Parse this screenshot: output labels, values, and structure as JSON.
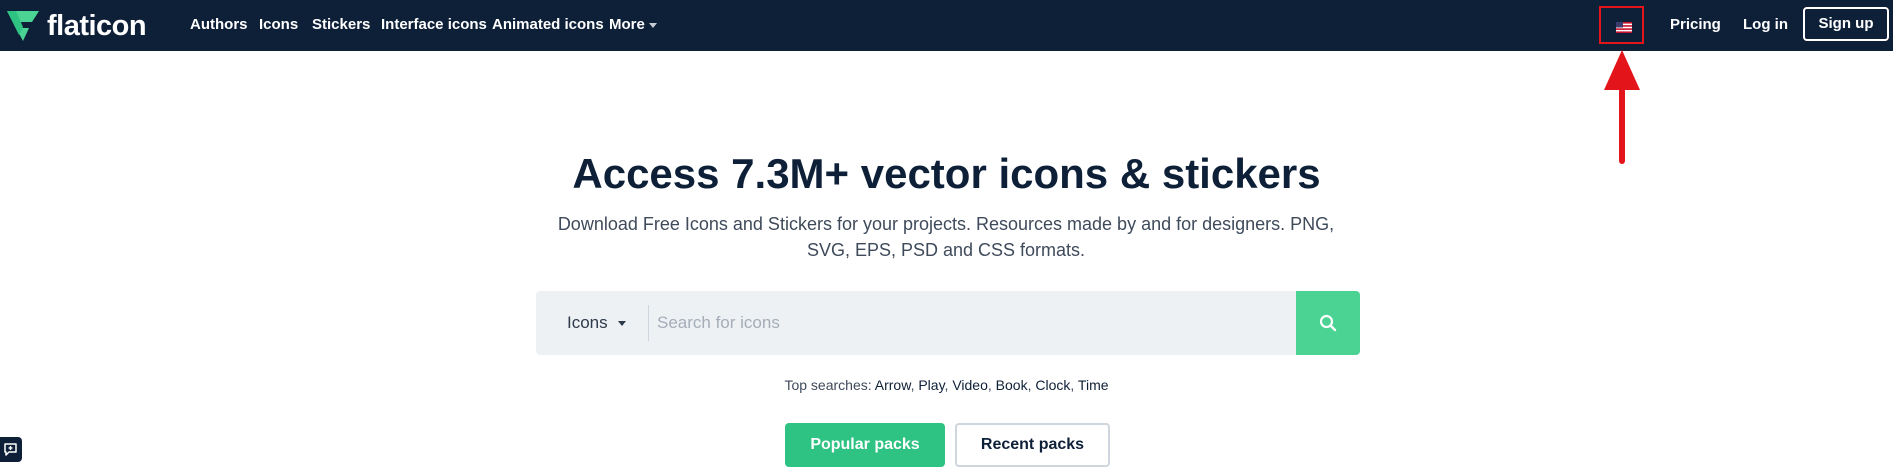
{
  "header": {
    "brand": "flaticon",
    "nav": [
      "Authors",
      "Icons",
      "Stickers",
      "Interface icons",
      "Animated icons",
      "More"
    ],
    "language_flag": "us-flag-icon",
    "pricing": "Pricing",
    "login": "Log in",
    "signup": "Sign up"
  },
  "hero": {
    "title": "Access 7.3M+ vector icons & stickers",
    "subtitle": "Download Free Icons and Stickers for your projects. Resources made by and for designers. PNG, SVG, EPS, PSD and CSS formats."
  },
  "search": {
    "category": "Icons",
    "placeholder": "Search for icons",
    "button_icon": "search-icon"
  },
  "top_searches": {
    "label": "Top searches:",
    "items": [
      "Arrow",
      "Play",
      "Video",
      "Book",
      "Clock",
      "Time"
    ]
  },
  "packs": {
    "popular": "Popular packs",
    "recent": "Recent packs"
  },
  "annotation": {
    "highlight_color": "#e4141b",
    "arrow": "red-up-arrow"
  },
  "colors": {
    "navbar": "#0e2038",
    "brand_green": "#4bd393",
    "button_green": "#2fc383"
  }
}
